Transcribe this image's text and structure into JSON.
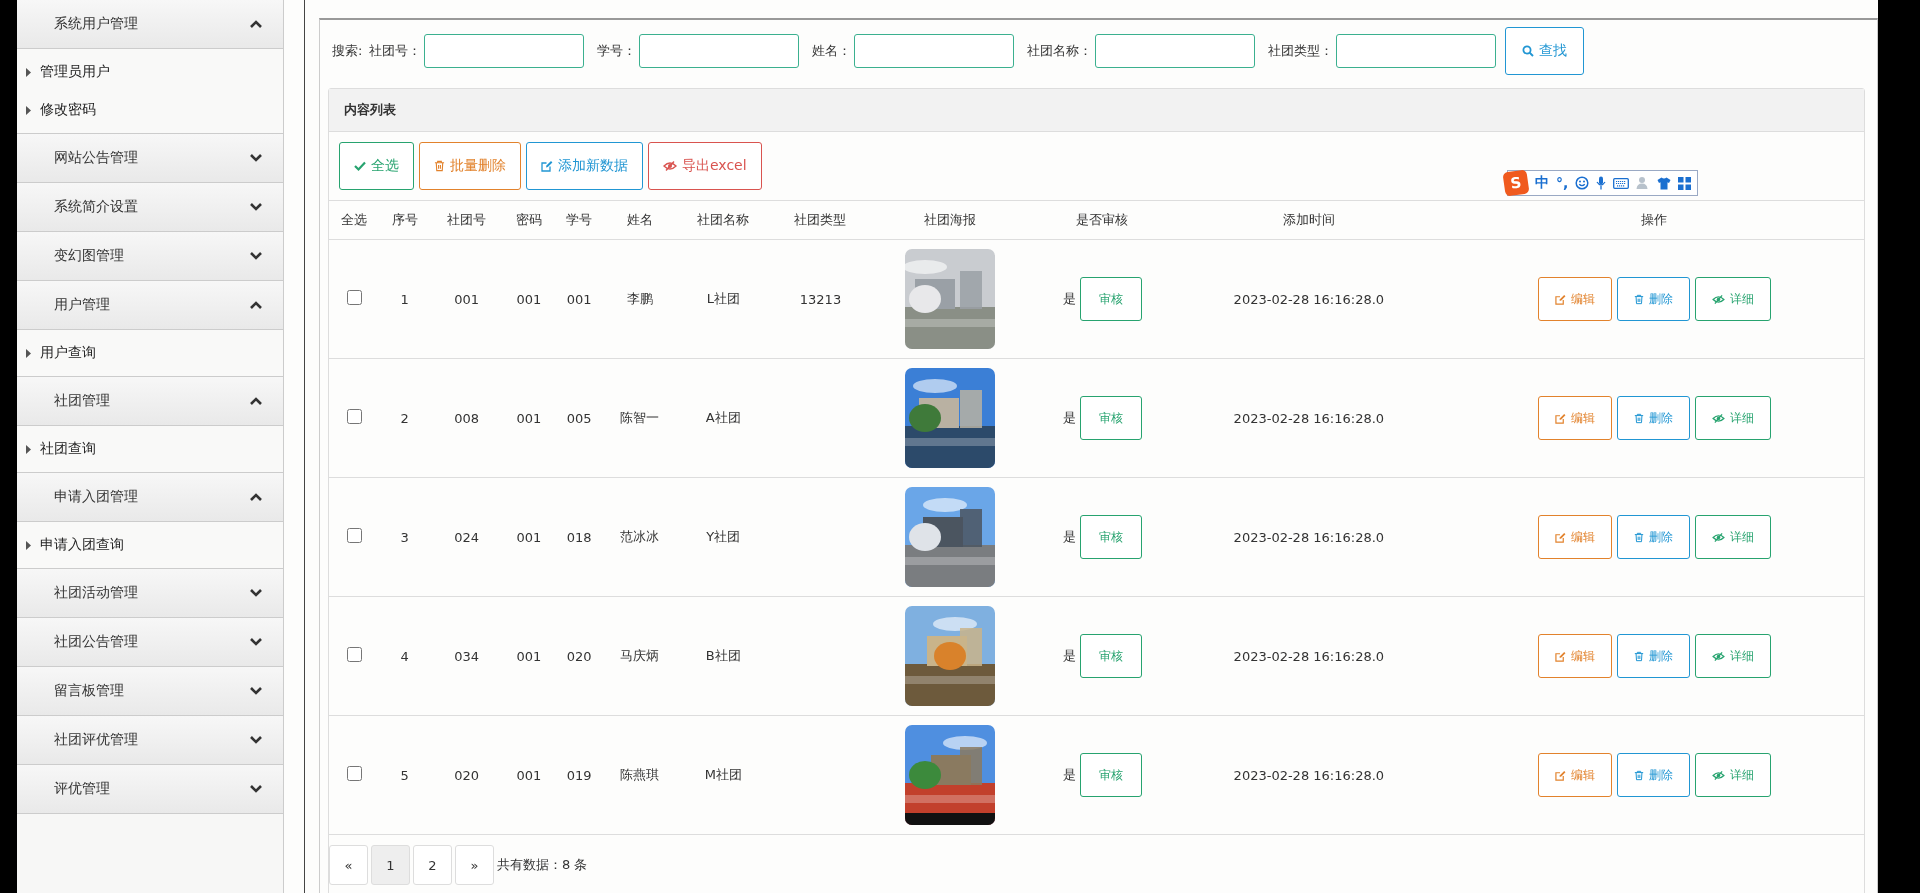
{
  "sidebar": {
    "groups": [
      {
        "title": "系统用户管理",
        "expanded": true,
        "children": [
          {
            "label": "管理员用户"
          },
          {
            "label": "修改密码"
          }
        ]
      },
      {
        "title": "网站公告管理",
        "expanded": false
      },
      {
        "title": "系统简介设置",
        "expanded": false
      },
      {
        "title": "变幻图管理",
        "expanded": false
      },
      {
        "title": "用户管理",
        "expanded": true,
        "children": [
          {
            "label": "用户查询"
          }
        ]
      },
      {
        "title": "社团管理",
        "expanded": true,
        "children": [
          {
            "label": "社团查询"
          }
        ]
      },
      {
        "title": "申请入团管理",
        "expanded": true,
        "children": [
          {
            "label": "申请入团查询"
          }
        ]
      },
      {
        "title": "社团活动管理",
        "expanded": false
      },
      {
        "title": "社团公告管理",
        "expanded": false
      },
      {
        "title": "留言板管理",
        "expanded": false
      },
      {
        "title": "社团评优管理",
        "expanded": false
      },
      {
        "title": "评优管理",
        "expanded": false
      }
    ]
  },
  "search": {
    "prefix": "搜索:",
    "fields": [
      {
        "label": "社团号："
      },
      {
        "label": "学号："
      },
      {
        "label": "姓名："
      },
      {
        "label": "社团名称："
      },
      {
        "label": "社团类型："
      }
    ],
    "button": "查找"
  },
  "panel": {
    "title": "内容列表",
    "toolbar": [
      {
        "kind": "select-all",
        "label": "全选"
      },
      {
        "kind": "batch-delete",
        "label": "批量删除"
      },
      {
        "kind": "add",
        "label": "添加新数据"
      },
      {
        "kind": "export",
        "label": "导出excel"
      }
    ],
    "ime": {
      "logo": "S",
      "mode": "中",
      "punct": "°,"
    },
    "columns": [
      "全选",
      "序号",
      "社团号",
      "密码",
      "学号",
      "姓名",
      "社团名称",
      "社团类型",
      "社团海报",
      "是否审核",
      "添加时间",
      "操作"
    ],
    "rows": [
      {
        "checked": false,
        "no": "1",
        "club_no": "001",
        "password": "001",
        "student_no": "001",
        "name": "李鹏",
        "club_name": "L社团",
        "club_type": "13213",
        "approved": "是",
        "review": "审核",
        "time": "2023-02-28 16:16:28.0",
        "actions": [
          "编辑",
          "删除",
          "详细"
        ]
      },
      {
        "checked": false,
        "no": "2",
        "club_no": "008",
        "password": "001",
        "student_no": "005",
        "name": "陈智一",
        "club_name": "A社团",
        "approved": "是",
        "review": "审核",
        "time": "2023-02-28 16:16:28.0",
        "actions": [
          "编辑",
          "删除",
          "详细"
        ]
      },
      {
        "checked": false,
        "no": "3",
        "club_no": "024",
        "password": "001",
        "student_no": "018",
        "name": "范冰冰",
        "club_name": "Y社团",
        "approved": "是",
        "review": "审核",
        "time": "2023-02-28 16:16:28.0",
        "actions": [
          "编辑",
          "删除",
          "详细"
        ]
      },
      {
        "checked": false,
        "no": "4",
        "club_no": "034",
        "password": "001",
        "student_no": "020",
        "name": "马庆炳",
        "club_name": "B社团",
        "approved": "是",
        "review": "审核",
        "time": "2023-02-28 16:16:28.0",
        "actions": [
          "编辑",
          "删除",
          "详细"
        ]
      },
      {
        "checked": false,
        "no": "5",
        "club_no": "020",
        "password": "001",
        "student_no": "019",
        "name": "陈燕琪",
        "club_name": "M社团",
        "approved": "是",
        "review": "审核",
        "time": "2023-02-28 16:16:28.0",
        "actions": [
          "编辑",
          "删除",
          "详细"
        ]
      }
    ],
    "pagination": {
      "prev": "«",
      "pages": [
        {
          "label": "1",
          "selected": true
        },
        {
          "label": "2",
          "selected": false
        }
      ],
      "next": "»",
      "total": "共有数据：8 条"
    }
  }
}
